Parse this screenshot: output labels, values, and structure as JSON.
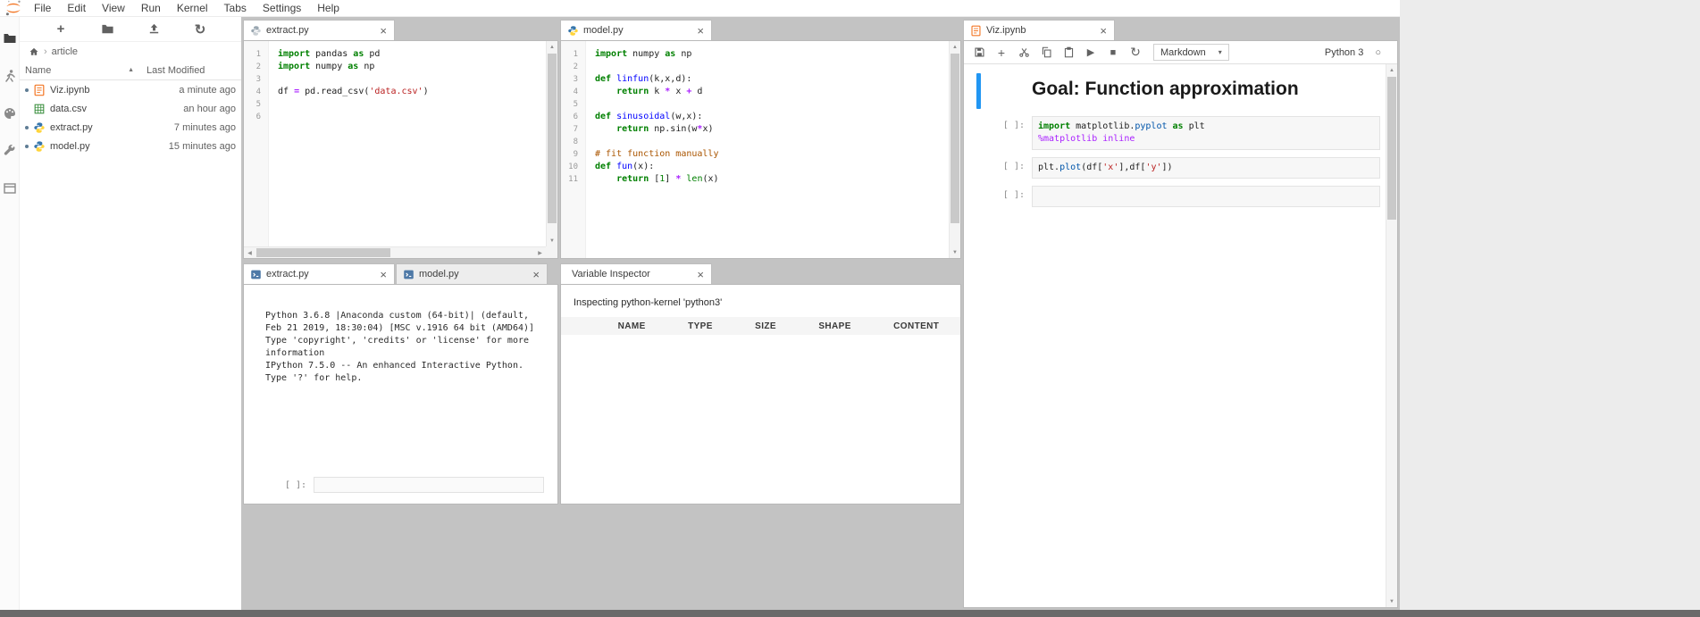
{
  "icons": {
    "close": "×",
    "sort_ascending": "▲",
    "breadcrumb_separator": "›",
    "caret_down": "▾",
    "plus": "+",
    "run": "▶",
    "stop": "■",
    "refresh": "↻",
    "kernel_idle": "○",
    "scroll_up": "▲",
    "scroll_down": "▼",
    "scroll_left": "◀",
    "scroll_right": "▶"
  },
  "menubar": {
    "items": [
      "File",
      "Edit",
      "View",
      "Run",
      "Kernel",
      "Tabs",
      "Settings",
      "Help"
    ]
  },
  "filebrowser": {
    "breadcrumb": {
      "folder": "article"
    },
    "header": {
      "name": "Name",
      "modified": "Last Modified"
    },
    "files": [
      {
        "name": "Viz.ipynb",
        "type": "notebook",
        "modified": "a minute ago",
        "open": true
      },
      {
        "name": "data.csv",
        "type": "csv",
        "modified": "an hour ago",
        "open": false
      },
      {
        "name": "extract.py",
        "type": "python",
        "modified": "7 minutes ago",
        "open": true
      },
      {
        "name": "model.py",
        "type": "python",
        "modified": "15 minutes ago",
        "open": true
      }
    ]
  },
  "editors": {
    "extract": {
      "tab": "extract.py",
      "lines": [
        [
          {
            "t": "import",
            "c": "kw"
          },
          {
            "t": " pandas "
          },
          {
            "t": "as",
            "c": "kw"
          },
          {
            "t": " pd"
          }
        ],
        [
          {
            "t": "import",
            "c": "kw"
          },
          {
            "t": " numpy "
          },
          {
            "t": "as",
            "c": "kw"
          },
          {
            "t": " np"
          }
        ],
        [],
        [
          {
            "t": "df "
          },
          {
            "t": "=",
            "c": "op"
          },
          {
            "t": " pd.read_csv("
          },
          {
            "t": "'data.csv'",
            "c": "str"
          },
          {
            "t": ")"
          }
        ],
        [],
        []
      ]
    },
    "model": {
      "tab": "model.py",
      "lines": [
        [
          {
            "t": "import",
            "c": "kw"
          },
          {
            "t": " numpy "
          },
          {
            "t": "as",
            "c": "kw"
          },
          {
            "t": " np"
          }
        ],
        [],
        [
          {
            "t": "def",
            "c": "kw"
          },
          {
            "t": " "
          },
          {
            "t": "linfun",
            "c": "def"
          },
          {
            "t": "(k,x,d):"
          }
        ],
        [
          {
            "t": "    "
          },
          {
            "t": "return",
            "c": "kw"
          },
          {
            "t": " k "
          },
          {
            "t": "*",
            "c": "op"
          },
          {
            "t": " x "
          },
          {
            "t": "+",
            "c": "op"
          },
          {
            "t": " d"
          }
        ],
        [],
        [
          {
            "t": "def",
            "c": "kw"
          },
          {
            "t": " "
          },
          {
            "t": "sinusoidal",
            "c": "def"
          },
          {
            "t": "(w,x):"
          }
        ],
        [
          {
            "t": "    "
          },
          {
            "t": "return",
            "c": "kw"
          },
          {
            "t": " np.sin(w"
          },
          {
            "t": "*",
            "c": "op"
          },
          {
            "t": "x)"
          }
        ],
        [],
        [
          {
            "t": "# fit function manually",
            "c": "com"
          }
        ],
        [
          {
            "t": "def",
            "c": "kw"
          },
          {
            "t": " "
          },
          {
            "t": "fun",
            "c": "def"
          },
          {
            "t": "(x):"
          }
        ],
        [
          {
            "t": "    "
          },
          {
            "t": "return",
            "c": "kw"
          },
          {
            "t": " ["
          },
          {
            "t": "1",
            "c": "num"
          },
          {
            "t": "] "
          },
          {
            "t": "*",
            "c": "op"
          },
          {
            "t": " "
          },
          {
            "t": "len",
            "c": "builtin"
          },
          {
            "t": "(x)"
          }
        ]
      ]
    }
  },
  "console": {
    "tabs": [
      "extract.py",
      "model.py"
    ],
    "banner": [
      "Python 3.6.8 |Anaconda custom (64-bit)| (default,",
      "Feb 21 2019, 18:30:04) [MSC v.1916 64 bit (AMD64)]",
      "Type 'copyright', 'credits' or 'license' for more",
      "information",
      "IPython 7.5.0 -- An enhanced Interactive Python.",
      "Type '?' for help."
    ],
    "prompt": "[ ]:"
  },
  "inspector": {
    "tab": "Variable Inspector",
    "status": "Inspecting python-kernel 'python3'",
    "columns": [
      "NAME",
      "TYPE",
      "SIZE",
      "SHAPE",
      "CONTENT"
    ]
  },
  "notebook": {
    "tab": "Viz.ipynb",
    "toolbar": {
      "cell_type": "Markdown",
      "kernel": "Python 3"
    },
    "cells": [
      {
        "kind": "markdown",
        "heading": "Goal: Function approximation",
        "selected": true
      },
      {
        "kind": "code",
        "prompt": "[ ]:",
        "lines": [
          [
            {
              "t": "import",
              "c": "kw"
            },
            {
              "t": " matplotlib."
            },
            {
              "t": "pyplot",
              "c": "prop"
            },
            {
              "t": " "
            },
            {
              "t": "as",
              "c": "kw"
            },
            {
              "t": " plt"
            }
          ],
          [
            {
              "t": "%matplotlib inline",
              "c": "magic"
            }
          ]
        ]
      },
      {
        "kind": "code",
        "prompt": "[ ]:",
        "lines": [
          [
            {
              "t": "plt."
            },
            {
              "t": "plot",
              "c": "prop"
            },
            {
              "t": "(df["
            },
            {
              "t": "'x'",
              "c": "str"
            },
            {
              "t": "],df["
            },
            {
              "t": "'y'",
              "c": "str"
            },
            {
              "t": "])"
            }
          ]
        ]
      },
      {
        "kind": "code",
        "prompt": "[ ]:",
        "lines": [
          []
        ]
      }
    ]
  }
}
